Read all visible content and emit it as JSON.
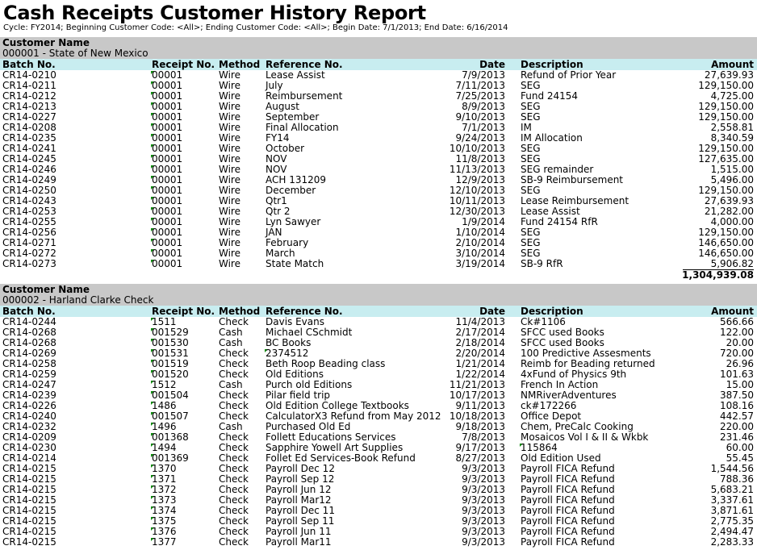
{
  "report": {
    "title": "Cash Receipts Customer History Report",
    "parameters": "Cycle: FY2014; Beginning Customer Code: <All>; Ending Customer Code: <All>; Begin Date: 7/1/2013; End Date: 6/16/2014"
  },
  "columns": {
    "batch": "Batch No.",
    "receipt": "Receipt No.",
    "method": "Method",
    "reference": "Reference No.",
    "date": "Date",
    "description": "Description",
    "amount": "Amount"
  },
  "customer_label": "Customer Name",
  "colors": {
    "customer_band": "#c8c8c8",
    "header_band": "#c8edf0",
    "cell_marker": "#0a8a0a"
  },
  "customers": [
    {
      "name": "000001 - State of New Mexico",
      "total": "1,304,939.08",
      "rows": [
        {
          "batch": "CR14-0210",
          "receipt": "00001",
          "method": "Wire",
          "reference": "Lease Assist",
          "date": "7/9/2013",
          "description": "Refund of Prior Year",
          "amount": "27,639.93"
        },
        {
          "batch": "CR14-0211",
          "receipt": "00001",
          "method": "Wire",
          "reference": "July",
          "date": "7/11/2013",
          "description": "SEG",
          "amount": "129,150.00"
        },
        {
          "batch": "CR14-0212",
          "receipt": "00001",
          "method": "Wire",
          "reference": "Reimbursement",
          "date": "7/25/2013",
          "description": "Fund 24154",
          "amount": "4,725.00"
        },
        {
          "batch": "CR14-0213",
          "receipt": "00001",
          "method": "Wire",
          "reference": "August",
          "date": "8/9/2013",
          "description": "SEG",
          "amount": "129,150.00"
        },
        {
          "batch": "CR14-0227",
          "receipt": "00001",
          "method": "Wire",
          "reference": "September",
          "date": "9/10/2013",
          "description": "SEG",
          "amount": "129,150.00"
        },
        {
          "batch": "CR14-0208",
          "receipt": "00001",
          "method": "Wire",
          "reference": "Final Allocation",
          "date": "7/1/2013",
          "description": "IM",
          "amount": "2,558.81"
        },
        {
          "batch": "CR14-0235",
          "receipt": "00001",
          "method": "Wire",
          "reference": "FY14",
          "date": "9/24/2013",
          "description": "IM Allocation",
          "amount": "8,340.59"
        },
        {
          "batch": "CR14-0241",
          "receipt": "00001",
          "method": "Wire",
          "reference": "October",
          "date": "10/10/2013",
          "description": "SEG",
          "amount": "129,150.00"
        },
        {
          "batch": "CR14-0245",
          "receipt": "00001",
          "method": "Wire",
          "reference": "NOV",
          "date": "11/8/2013",
          "description": "SEG",
          "amount": "127,635.00"
        },
        {
          "batch": "CR14-0246",
          "receipt": "00001",
          "method": "Wire",
          "reference": "NOV",
          "date": "11/13/2013",
          "description": "SEG remainder",
          "amount": "1,515.00"
        },
        {
          "batch": "CR14-0249",
          "receipt": "00001",
          "method": "Wire",
          "reference": "ACH 131209",
          "date": "12/9/2013",
          "description": "SB-9 Reimbursement",
          "amount": "5,496.00"
        },
        {
          "batch": "CR14-0250",
          "receipt": "00001",
          "method": "Wire",
          "reference": "December",
          "date": "12/10/2013",
          "description": "SEG",
          "amount": "129,150.00"
        },
        {
          "batch": "CR14-0243",
          "receipt": "00001",
          "method": "Wire",
          "reference": "Qtr1",
          "date": "10/11/2013",
          "description": "Lease Reimbursement",
          "amount": "27,639.93"
        },
        {
          "batch": "CR14-0253",
          "receipt": "00001",
          "method": "Wire",
          "reference": "Qtr 2",
          "date": "12/30/2013",
          "description": "Lease Assist",
          "amount": "21,282.00"
        },
        {
          "batch": "CR14-0255",
          "receipt": "00001",
          "method": "Wire",
          "reference": "Lyn Sawyer",
          "date": "1/9/2014",
          "description": "Fund 24154 RfR",
          "amount": "4,000.00"
        },
        {
          "batch": "CR14-0256",
          "receipt": "00001",
          "method": "Wire",
          "reference": "JAN",
          "date": "1/10/2014",
          "description": "SEG",
          "amount": "129,150.00"
        },
        {
          "batch": "CR14-0271",
          "receipt": "00001",
          "method": "Wire",
          "reference": "February",
          "date": "2/10/2014",
          "description": "SEG",
          "amount": "146,650.00"
        },
        {
          "batch": "CR14-0272",
          "receipt": "00001",
          "method": "Wire",
          "reference": "March",
          "date": "3/10/2014",
          "description": "SEG",
          "amount": "146,650.00"
        },
        {
          "batch": "CR14-0273",
          "receipt": "00001",
          "method": "Wire",
          "reference": "State Match",
          "date": "3/19/2014",
          "description": "SB-9 RfR",
          "amount": "5,906.82"
        }
      ]
    },
    {
      "name": "000002 - Harland Clarke Check",
      "total": "",
      "rows": [
        {
          "batch": "CR14-0244",
          "receipt": "1511",
          "method": "Check",
          "reference": "Davis Evans",
          "date": "11/4/2013",
          "description": "Ck#1106",
          "amount": "566.66"
        },
        {
          "batch": "CR14-0268",
          "receipt": "001529",
          "method": "Cash",
          "reference": "Michael CSchmidt",
          "date": "2/17/2014",
          "description": "SFCC used Books",
          "amount": "122.00"
        },
        {
          "batch": "CR14-0268",
          "receipt": "001530",
          "method": "Cash",
          "reference": "BC Books",
          "date": "2/18/2014",
          "description": "SFCC used Books",
          "amount": "20.00"
        },
        {
          "batch": "CR14-0269",
          "receipt": "001531",
          "method": "Check",
          "reference": "2374512",
          "date": "2/20/2014",
          "description": "100 Predictive Assesments",
          "amount": "720.00",
          "ref_marker": true
        },
        {
          "batch": "CR14-0258",
          "receipt": "001519",
          "method": "Check",
          "reference": "Beth Roop Beading class",
          "date": "1/21/2014",
          "description": "Reimb for Beading returned",
          "amount": "26.96"
        },
        {
          "batch": "CR14-0259",
          "receipt": "001520",
          "method": "Check",
          "reference": "Old Editions",
          "date": "1/22/2014",
          "description": "4xFund of Physics 9th",
          "amount": "101.63"
        },
        {
          "batch": "CR14-0247",
          "receipt": "1512",
          "method": "Cash",
          "reference": "Purch old Editions",
          "date": "11/21/2013",
          "description": "French In Action",
          "amount": "15.00"
        },
        {
          "batch": "CR14-0239",
          "receipt": "001504",
          "method": "Check",
          "reference": "Pilar field trip",
          "date": "10/17/2013",
          "description": "NMRiverAdventures",
          "amount": "387.50"
        },
        {
          "batch": "CR14-0226",
          "receipt": "1486",
          "method": "Check",
          "reference": "Old Edition College Textbooks",
          "date": "9/11/2013",
          "description": "ck#172266",
          "amount": "108.16"
        },
        {
          "batch": "CR14-0240",
          "receipt": "001507",
          "method": "Check",
          "reference": "CalculatorX3 Refund from May 2012",
          "date": "10/18/2013",
          "description": "Office Depot",
          "amount": "442.57"
        },
        {
          "batch": "CR14-0232",
          "receipt": "1496",
          "method": "Cash",
          "reference": "Purchased Old Ed",
          "date": "9/18/2013",
          "description": "Chem, PreCalc Cooking",
          "amount": "220.00"
        },
        {
          "batch": "CR14-0209",
          "receipt": "001368",
          "method": "Check",
          "reference": "Follett Educations Services",
          "date": "7/8/2013",
          "description": "Mosaicos Vol I & II & Wkbk",
          "amount": "231.46"
        },
        {
          "batch": "CR14-0230",
          "receipt": "1494",
          "method": "Check",
          "reference": "Sapphire Yowell Art Supplies",
          "date": "9/17/2013",
          "description": "115864",
          "amount": "60.00",
          "desc_marker": true
        },
        {
          "batch": "CR14-0214",
          "receipt": "001369",
          "method": "Check",
          "reference": "Follet Ed Services-Book Refund",
          "date": "8/27/2013",
          "description": "Old Edition Used",
          "amount": "55.45"
        },
        {
          "batch": "CR14-0215",
          "receipt": "1370",
          "method": "Check",
          "reference": "Payroll Dec 12",
          "date": "9/3/2013",
          "description": "Payroll FICA Refund",
          "amount": "1,544.56"
        },
        {
          "batch": "CR14-0215",
          "receipt": "1371",
          "method": "Check",
          "reference": "Payroll Sep 12",
          "date": "9/3/2013",
          "description": "Payroll FICA Refund",
          "amount": "788.36"
        },
        {
          "batch": "CR14-0215",
          "receipt": "1372",
          "method": "Check",
          "reference": "Payroll Jun 12",
          "date": "9/3/2013",
          "description": "Payroll FICA Refund",
          "amount": "5,683.21"
        },
        {
          "batch": "CR14-0215",
          "receipt": "1373",
          "method": "Check",
          "reference": "Payroll Mar12",
          "date": "9/3/2013",
          "description": "Payroll FICA Refund",
          "amount": "3,337.61"
        },
        {
          "batch": "CR14-0215",
          "receipt": "1374",
          "method": "Check",
          "reference": "Payroll Dec 11",
          "date": "9/3/2013",
          "description": "Payroll FICA Refund",
          "amount": "3,871.61"
        },
        {
          "batch": "CR14-0215",
          "receipt": "1375",
          "method": "Check",
          "reference": "Payroll Sep 11",
          "date": "9/3/2013",
          "description": "Payroll FICA Refund",
          "amount": "2,775.35"
        },
        {
          "batch": "CR14-0215",
          "receipt": "1376",
          "method": "Check",
          "reference": "Payroll Jun 11",
          "date": "9/3/2013",
          "description": "Payroll FICA Refund",
          "amount": "2,494.47"
        },
        {
          "batch": "CR14-0215",
          "receipt": "1377",
          "method": "Check",
          "reference": "Payroll Mar11",
          "date": "9/3/2013",
          "description": "Payroll FICA Refund",
          "amount": "2,283.33"
        }
      ]
    }
  ]
}
